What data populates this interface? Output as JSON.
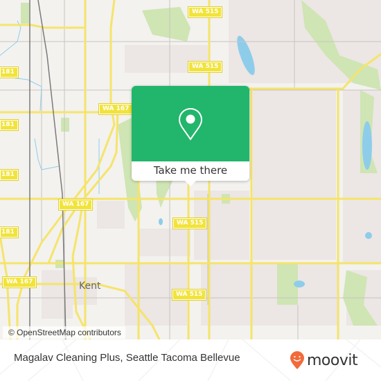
{
  "map": {
    "colors": {
      "background": "#f3f2ef",
      "urban": "#ece6e4",
      "park": "#cfe5b4",
      "water": "#8ecdea",
      "road_major": "#f5e46a",
      "road_minor": "#c9c4bf",
      "rail": "#7a7a7a"
    },
    "road_shields": [
      {
        "label": "WA 515"
      },
      {
        "label": "WA 515"
      },
      {
        "label": "WA 167"
      },
      {
        "label": "181"
      },
      {
        "label": "181"
      },
      {
        "label": "181"
      },
      {
        "label": "WA 167"
      },
      {
        "label": "WA 515"
      },
      {
        "label": "181"
      },
      {
        "label": "WA 167"
      },
      {
        "label": "WA 515"
      }
    ],
    "place_labels": [
      {
        "label": "Kent"
      }
    ],
    "attribution": "© OpenStreetMap contributors"
  },
  "popup": {
    "icon": "map-pin-icon",
    "button_label": "Take me there",
    "color": "#21b66b"
  },
  "footer": {
    "title": "Magalav Cleaning Plus, Seattle Tacoma Bellevue",
    "brand": "moovit",
    "brand_color": "#f26b3a"
  }
}
